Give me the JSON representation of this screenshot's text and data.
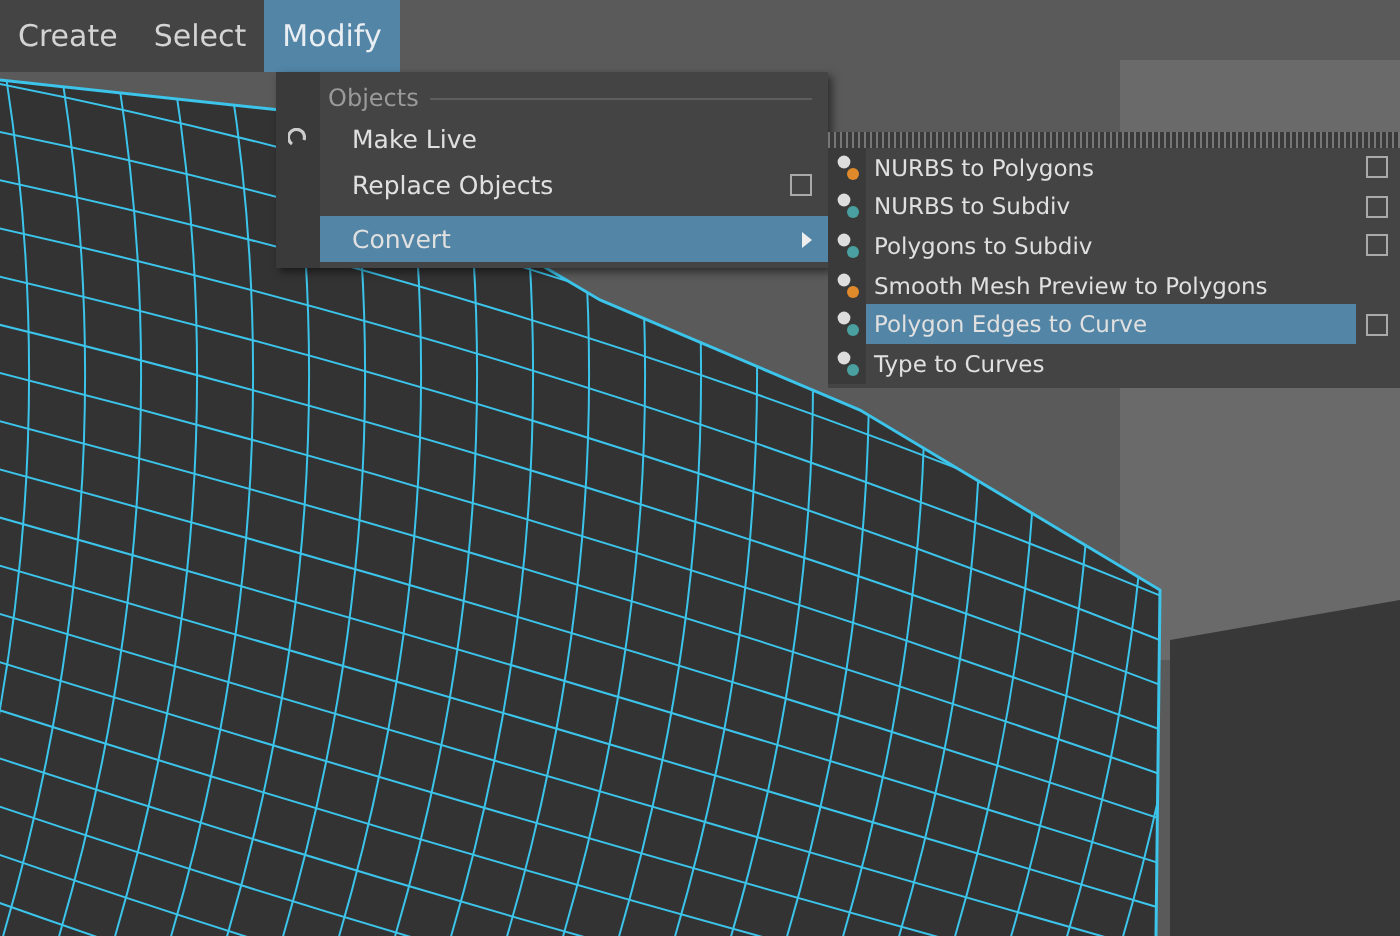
{
  "menu_bar": [
    {
      "label": "Create",
      "selected": false
    },
    {
      "label": "Select",
      "selected": false
    },
    {
      "label": "Modify",
      "selected": true
    }
  ],
  "modify_menu": {
    "section": "Objects",
    "items": [
      {
        "label": "Make Live",
        "kind": "item",
        "option_box": false,
        "selected": false
      },
      {
        "label": "Replace Objects",
        "kind": "item",
        "option_box": true,
        "selected": false
      },
      {
        "label": "Convert",
        "kind": "submenu",
        "option_box": false,
        "selected": true
      }
    ]
  },
  "convert_submenu": {
    "items": [
      {
        "label": "NURBS to Polygons",
        "option_box": true,
        "selected": false
      },
      {
        "label": "NURBS to Subdiv",
        "option_box": true,
        "selected": false
      },
      {
        "label": "Polygons to Subdiv",
        "option_box": true,
        "selected": false
      },
      {
        "label": "Smooth Mesh Preview to Polygons",
        "option_box": false,
        "selected": false
      },
      {
        "label": "Polygon Edges to Curve",
        "option_box": true,
        "selected": true
      },
      {
        "label": "Type to Curves",
        "option_box": false,
        "selected": false
      }
    ]
  }
}
